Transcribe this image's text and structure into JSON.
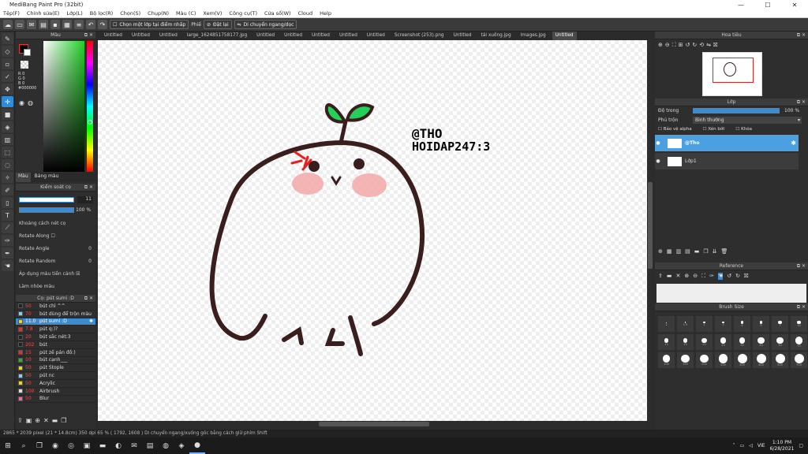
{
  "window": {
    "title": "MediBang Paint Pro (32bit)",
    "minimize": "—",
    "maximize": "☐",
    "close": "✕"
  },
  "menu": [
    "Tệp(F)",
    "Chỉnh sửa(E)",
    "Lớp(L)",
    "Bộ lọc(R)",
    "Chọn(S)",
    "Chụp(N)",
    "Màu (C)",
    "Xem(V)",
    "Công cụ(T)",
    "Cửa sổ(W)",
    "Cloud",
    "Help"
  ],
  "toolbar": {
    "snap_label": "Chọn một lớp tại điểm nhấp",
    "flip_label": "Phiế",
    "reset_label": "Đặt lại",
    "flip_hv_label": "Di chuyển ngang/dọc"
  },
  "color_panel": {
    "title": "Màu",
    "r": "R 0",
    "g": "G 0",
    "b": "B 0",
    "hex": "#000000",
    "tab_color": "Màu",
    "tab_palette": "Bảng màu"
  },
  "brush_control": {
    "title": "Kiểm soát cọ",
    "size_value": "11",
    "opacity_value": "100 %",
    "spacing_label": "Khoảng cách nét cọ",
    "rotate_along_label": "Rotate Along",
    "rotate_angle_label": "Rotate Angle",
    "rotate_angle_value": "0",
    "rotate_random_label": "Rotate Random",
    "rotate_random_value": "0",
    "apply_color_label": "Áp dụng màu tiền cảnh",
    "blend_label": "Làm nhòe màu"
  },
  "brush_list": {
    "title": "Cọ: pút sumi :D",
    "items": [
      {
        "size": "50",
        "name": "bút chì ^^",
        "color": "#222222"
      },
      {
        "size": "70",
        "name": "bút dùng để trộn màu",
        "color": "#88ccee"
      },
      {
        "size": "11.0",
        "name": "pút sumi :D",
        "color": "#f2d21e",
        "selected": true
      },
      {
        "size": "7.8",
        "name": "pút q:)?",
        "color": "#e03030"
      },
      {
        "size": "20",
        "name": "bút sắc nét:3",
        "color": "#222222"
      },
      {
        "size": "202",
        "name": "bút",
        "color": "#222222"
      },
      {
        "size": "15",
        "name": "pút zế pán đồ:)",
        "color": "#e03030"
      },
      {
        "size": "10",
        "name": "bút cạnh___",
        "color": "#33aa33"
      },
      {
        "size": "50",
        "name": "pút Stople",
        "color": "#f2d21e"
      },
      {
        "size": "50",
        "name": "pút nc",
        "color": "#88ccee"
      },
      {
        "size": "50",
        "name": "Acrylic",
        "color": "#f2d21e"
      },
      {
        "size": "100",
        "name": "Airbrush",
        "color": "#dddddd"
      },
      {
        "size": "50",
        "name": "Blur",
        "color": "#ee66aa"
      }
    ]
  },
  "tabs": [
    "Untitled",
    "Untitled",
    "Untitled",
    "large_1624851758177.jpg",
    "Untitled",
    "Untitled",
    "Untitled",
    "Untitled",
    "Untitled",
    "Screenshot (253).png",
    "Untitled",
    "tải xuống.jpg",
    "Images.jpg",
    "Untitled"
  ],
  "canvas_text": {
    "line1": "@THO",
    "line2": "HOIDAP247:3"
  },
  "status": "2865 * 2039 pixel  (21 * 14.8cm)  350 dpi  65 %  ( 1792, 1608 )  Di chuyển ngang/xuống góc bằng cách giữ phím Shift",
  "navigator": {
    "title": "Hoa tiêu"
  },
  "layers": {
    "title": "Lớp",
    "opacity_label": "Độ trong",
    "opacity_value": "100 %",
    "blend_label": "Phủ trộn",
    "blend_value": "Bình thường",
    "protect_alpha": "Bảo vệ alpha",
    "clipping": "Xén bớt",
    "lock": "Khóa",
    "items": [
      {
        "name": "@Tho",
        "active": true
      },
      {
        "name": "Lớp1",
        "active": false
      }
    ]
  },
  "reference": {
    "title": "Reference"
  },
  "brush_size": {
    "title": "Brush Size",
    "sizes": [
      "1",
      "1.5",
      "2",
      "3",
      "4",
      "5",
      "7",
      "10",
      "12",
      "15",
      "20",
      "25",
      "30",
      "40",
      "50",
      "70",
      "100",
      "150",
      "200",
      "250",
      "300",
      "400",
      "500",
      "700"
    ]
  },
  "taskbar": {
    "lang": "VIE",
    "time": "1:10 PM",
    "date": "6/28/2021"
  },
  "colors": {
    "accent": "#3f8bd0",
    "sprout": "#22d15a",
    "ink": "#3a1e1e",
    "blush": "#f4a8a8",
    "angry": "#e81f1f"
  }
}
